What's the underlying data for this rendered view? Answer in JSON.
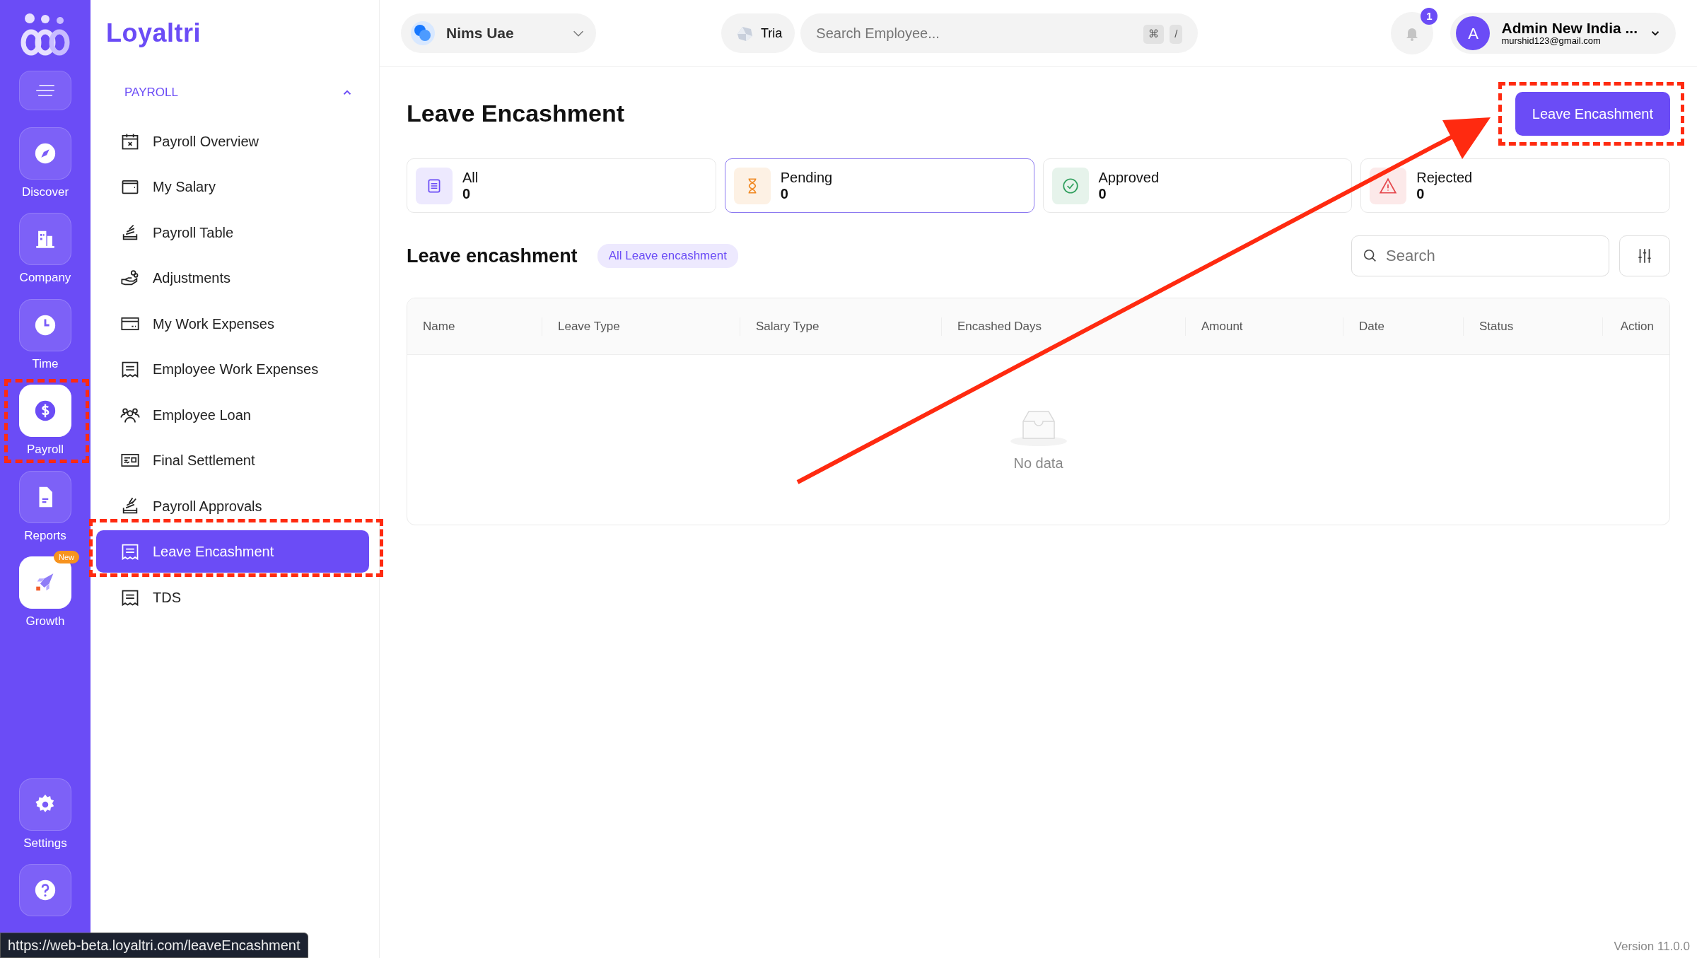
{
  "rail": {
    "items": [
      {
        "label": "Discover",
        "kind": "nav",
        "selected": false
      },
      {
        "label": "Company",
        "kind": "nav",
        "selected": false
      },
      {
        "label": "Time",
        "kind": "nav",
        "selected": false
      },
      {
        "label": "Payroll",
        "kind": "nav",
        "selected": true,
        "annotated": true
      },
      {
        "label": "Reports",
        "kind": "nav",
        "selected": false
      },
      {
        "label": "Growth",
        "kind": "promo",
        "selected": false,
        "badge": "New"
      }
    ],
    "bottom_items": [
      {
        "label": "Settings",
        "selected": false
      },
      {
        "selected": false
      }
    ]
  },
  "sidebar": {
    "brand": "Loyaltri",
    "section": {
      "title": "PAYROLL",
      "expanded": true
    },
    "items": [
      {
        "label": "Payroll Overview",
        "selected": false
      },
      {
        "label": "My Salary",
        "selected": false
      },
      {
        "label": "Payroll Table",
        "selected": false
      },
      {
        "label": "Adjustments",
        "selected": false
      },
      {
        "label": "My Work Expenses",
        "selected": false
      },
      {
        "label": "Employee Work Expenses",
        "selected": false
      },
      {
        "label": "Employee Loan",
        "selected": false
      },
      {
        "label": "Final Settlement",
        "selected": false
      },
      {
        "label": "Payroll Approvals",
        "selected": false
      },
      {
        "label": "Leave Encashment",
        "selected": true,
        "annotated": true
      },
      {
        "label": "TDS",
        "selected": false
      }
    ]
  },
  "topbar": {
    "company": "Nims Uae",
    "assistant": "Tria",
    "search": {
      "placeholder": "Search Employee...",
      "keys": [
        "⌘",
        "/"
      ]
    },
    "notifications": "1",
    "user": {
      "initial": "A",
      "name": "Admin New India ...",
      "email": "murshid123@gmail.com"
    }
  },
  "page": {
    "title": "Leave Encashment",
    "action_button": {
      "label": "Leave Encashment",
      "annotated": true
    },
    "stats": [
      {
        "label": "All",
        "count": "0",
        "color": "#6b4cf6",
        "selected": false
      },
      {
        "label": "Pending",
        "count": "0",
        "color": "#f08a24",
        "selected": true
      },
      {
        "label": "Approved",
        "count": "0",
        "color": "#2e9e5b",
        "selected": false
      },
      {
        "label": "Rejected",
        "count": "0",
        "color": "#e5484d",
        "selected": false
      }
    ],
    "section_title": "Leave encashment",
    "filter_chip": "All Leave encashment",
    "search": {
      "placeholder": "Search"
    },
    "table": {
      "columns": [
        "Name",
        "Leave Type",
        "Salary Type",
        "Encashed Days",
        "Amount",
        "Date",
        "Status",
        "Action"
      ],
      "empty_text": "No data"
    }
  },
  "annotation_arrow": true,
  "version": "Version 11.0.0",
  "status_url": "https://web-beta.loyaltri.com/leaveEncashment"
}
